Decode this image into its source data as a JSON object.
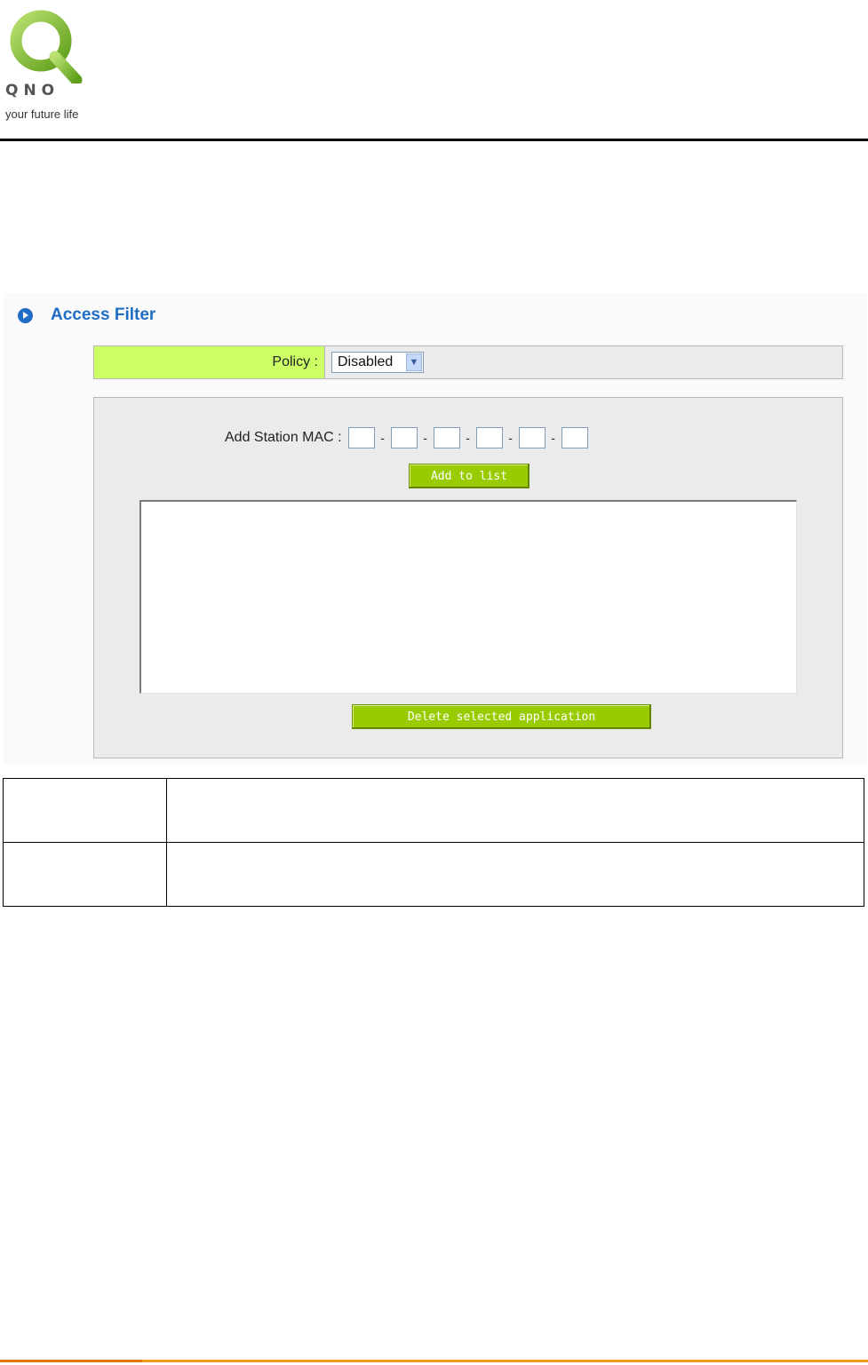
{
  "logo": {
    "brand": "QNO",
    "tagline": "your future life",
    "colors": {
      "ring": "#8cc63f",
      "text": "#555555"
    }
  },
  "access_filter": {
    "title": "Access Filter",
    "policy_label": "Policy :",
    "policy_value": "Disabled",
    "mac_label": "Add Station MAC :",
    "mac_octets": [
      "",
      "",
      "",
      "",
      "",
      ""
    ],
    "mac_separator": "-",
    "add_button": "Add to list",
    "list_items": [],
    "delete_button": "Delete selected application",
    "colors": {
      "accent": "#99cc00",
      "label_bg": "#ccff66",
      "title": "#1f6dc4"
    }
  },
  "description_table": {
    "rows": [
      {
        "term": "",
        "description": ""
      },
      {
        "term": "",
        "description": ""
      }
    ]
  }
}
